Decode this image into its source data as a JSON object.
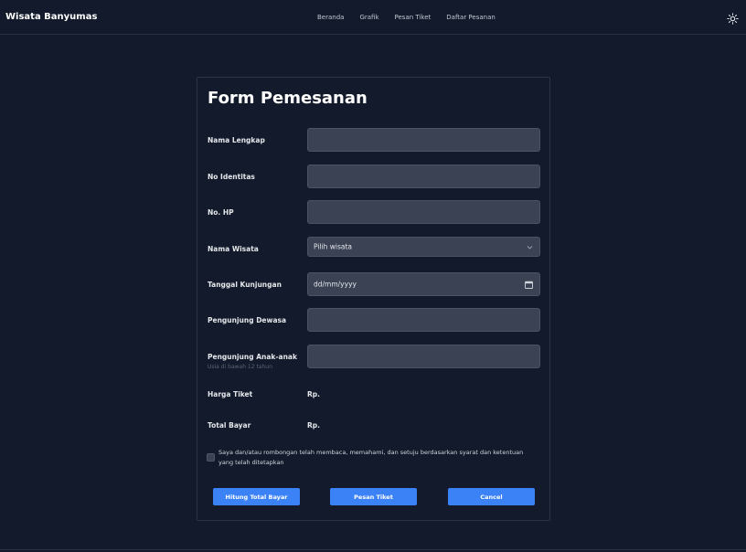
{
  "navbar": {
    "brand": "Wisata Banyumas",
    "links": [
      "Beranda",
      "Grafik",
      "Pesan Tiket",
      "Daftar Pesanan"
    ],
    "theme_icon": "sun-icon"
  },
  "form": {
    "title": "Form Pemesanan",
    "fields": {
      "nama_lengkap": {
        "label": "Nama Lengkap",
        "value": ""
      },
      "no_identitas": {
        "label": "No Identitas",
        "value": ""
      },
      "no_hp": {
        "label": "No. HP",
        "value": ""
      },
      "nama_wisata": {
        "label": "Nama Wisata",
        "selected": "Pilih wisata"
      },
      "tanggal": {
        "label": "Tanggal Kunjungan",
        "placeholder": "dd/mm/yyyy"
      },
      "dewasa": {
        "label": "Pengunjung Dewasa",
        "value": ""
      },
      "anak": {
        "label": "Pengunjung Anak-anak",
        "hint": "Usia di bawah 12 tahun",
        "value": ""
      }
    },
    "harga_tiket": {
      "label": "Harga Tiket",
      "value": "Rp."
    },
    "total_bayar": {
      "label": "Total Bayar",
      "value": "Rp."
    },
    "agreement": "Saya dan/atau rombongan telah membaca, memahami, dan setuju berdasarkan syarat dan ketentuan yang telah ditetapkan",
    "buttons": {
      "hitung": "Hitung Total Bayar",
      "pesan": "Pesan Tiket",
      "cancel": "Cancel"
    }
  },
  "colors": {
    "background": "#121a2b",
    "field": "#3a4253",
    "accent": "#3b82f6"
  }
}
